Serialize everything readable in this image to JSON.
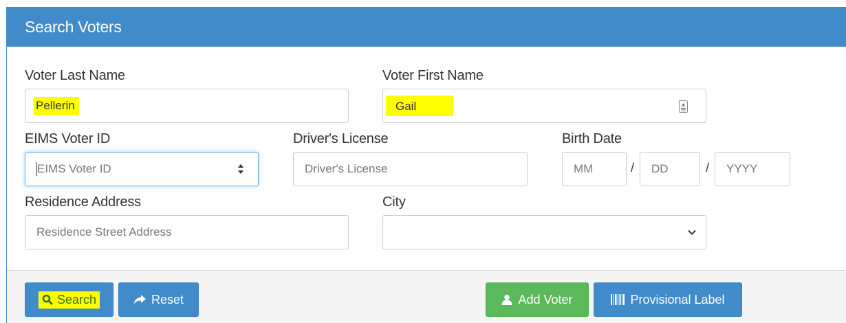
{
  "panel": {
    "title": "Search Voters"
  },
  "fields": {
    "last_name": {
      "label": "Voter Last Name",
      "value": "Pellerin"
    },
    "first_name": {
      "label": "Voter First Name",
      "value": "Gail"
    },
    "eims_id": {
      "label": "EIMS Voter ID",
      "placeholder": "EIMS Voter ID"
    },
    "drivers_license": {
      "label": "Driver's License",
      "placeholder": "Driver's License"
    },
    "birth_date": {
      "label": "Birth Date",
      "month_placeholder": "MM",
      "day_placeholder": "DD",
      "year_placeholder": "YYYY",
      "separator": "/"
    },
    "residence_address": {
      "label": "Residence Address",
      "placeholder": "Residence Street Address"
    },
    "city": {
      "label": "City",
      "value": ""
    }
  },
  "buttons": {
    "search": {
      "label": "Search",
      "icon": "search-icon"
    },
    "reset": {
      "label": "Reset",
      "icon": "share-arrow-icon"
    },
    "add_voter": {
      "label": "Add Voter",
      "icon": "user-icon"
    },
    "provisional_label": {
      "label": "Provisional Label",
      "icon": "barcode-icon"
    }
  },
  "colors": {
    "primary": "#428bca",
    "success": "#5cb85c",
    "highlight": "#ffff00"
  }
}
